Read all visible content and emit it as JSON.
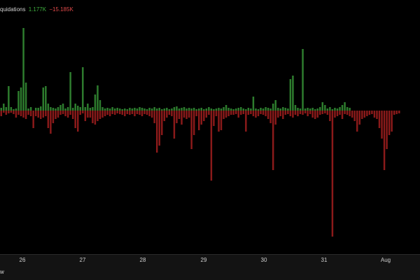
{
  "legend": {
    "label": "quidations",
    "long_value": "1.177K",
    "short_value": "−15.185K"
  },
  "bottom_tab": "w",
  "colors": {
    "background": "#000000",
    "positive": "#2e7d2e",
    "negative": "#8b1a1a"
  },
  "chart_data": {
    "type": "bar",
    "title": "",
    "x_ticks": [
      "26",
      "27",
      "28",
      "29",
      "30",
      "31",
      "Aug"
    ],
    "y_zero": 0,
    "series": [
      {
        "values": [
          4,
          10,
          5,
          35,
          5,
          2,
          3,
          28,
          33,
          118,
          40,
          3,
          5,
          0,
          4,
          4,
          6,
          33,
          35,
          10,
          5,
          4,
          3,
          5,
          8,
          10,
          3,
          5,
          55,
          4,
          10,
          7,
          5,
          62,
          5,
          10,
          4,
          5,
          23,
          36,
          15,
          5,
          3,
          4,
          3,
          5,
          3,
          4,
          3,
          2,
          3,
          2,
          4,
          3,
          4,
          3,
          5,
          4,
          3,
          2,
          4,
          3,
          5,
          3,
          4,
          2,
          3,
          4,
          2,
          3,
          5,
          6,
          3,
          4,
          5,
          3,
          4,
          3,
          4,
          2,
          3,
          4,
          2,
          3,
          5,
          3,
          2,
          3,
          4,
          3,
          5,
          8,
          4,
          3,
          2,
          3,
          4,
          5,
          3,
          2,
          4,
          3,
          20,
          3,
          2,
          4,
          3,
          5,
          4,
          3,
          10,
          15,
          4,
          3,
          5,
          4,
          3,
          45,
          50,
          8,
          4,
          3,
          88,
          3,
          4,
          3,
          4,
          2,
          3,
          5,
          12,
          8,
          3,
          5,
          2,
          4,
          3,
          5,
          8,
          12,
          5,
          4
        ],
        "negative": [
          8,
          3,
          6,
          4,
          3,
          5,
          10,
          6,
          8,
          10,
          12,
          6,
          8,
          25,
          8,
          10,
          12,
          10,
          8,
          25,
          33,
          18,
          12,
          10,
          6,
          5,
          8,
          10,
          6,
          12,
          25,
          30,
          6,
          4,
          15,
          10,
          10,
          18,
          20,
          15,
          12,
          10,
          8,
          6,
          8,
          5,
          6,
          4,
          5,
          6,
          8,
          5,
          6,
          5,
          8,
          5,
          6,
          8,
          5,
          6,
          8,
          10,
          18,
          60,
          50,
          35,
          15,
          10,
          6,
          8,
          40,
          18,
          12,
          20,
          10,
          12,
          10,
          55,
          35,
          8,
          28,
          20,
          15,
          10,
          6,
          100,
          22,
          8,
          30,
          28,
          12,
          10,
          8,
          6,
          6,
          5,
          10,
          6,
          5,
          30,
          6,
          5,
          8,
          10,
          8,
          5,
          6,
          8,
          12,
          18,
          85,
          20,
          10,
          8,
          12,
          6,
          5,
          8,
          10,
          6,
          8,
          5,
          6,
          4,
          8,
          5,
          10,
          12,
          10,
          6,
          5,
          4,
          6,
          15,
          180,
          10,
          8,
          6,
          12,
          5,
          6,
          8,
          10,
          15,
          30,
          20,
          12,
          10,
          8,
          6,
          5,
          10,
          12,
          25,
          40,
          85,
          55,
          35,
          30,
          6,
          5,
          4
        ]
      }
    ]
  }
}
